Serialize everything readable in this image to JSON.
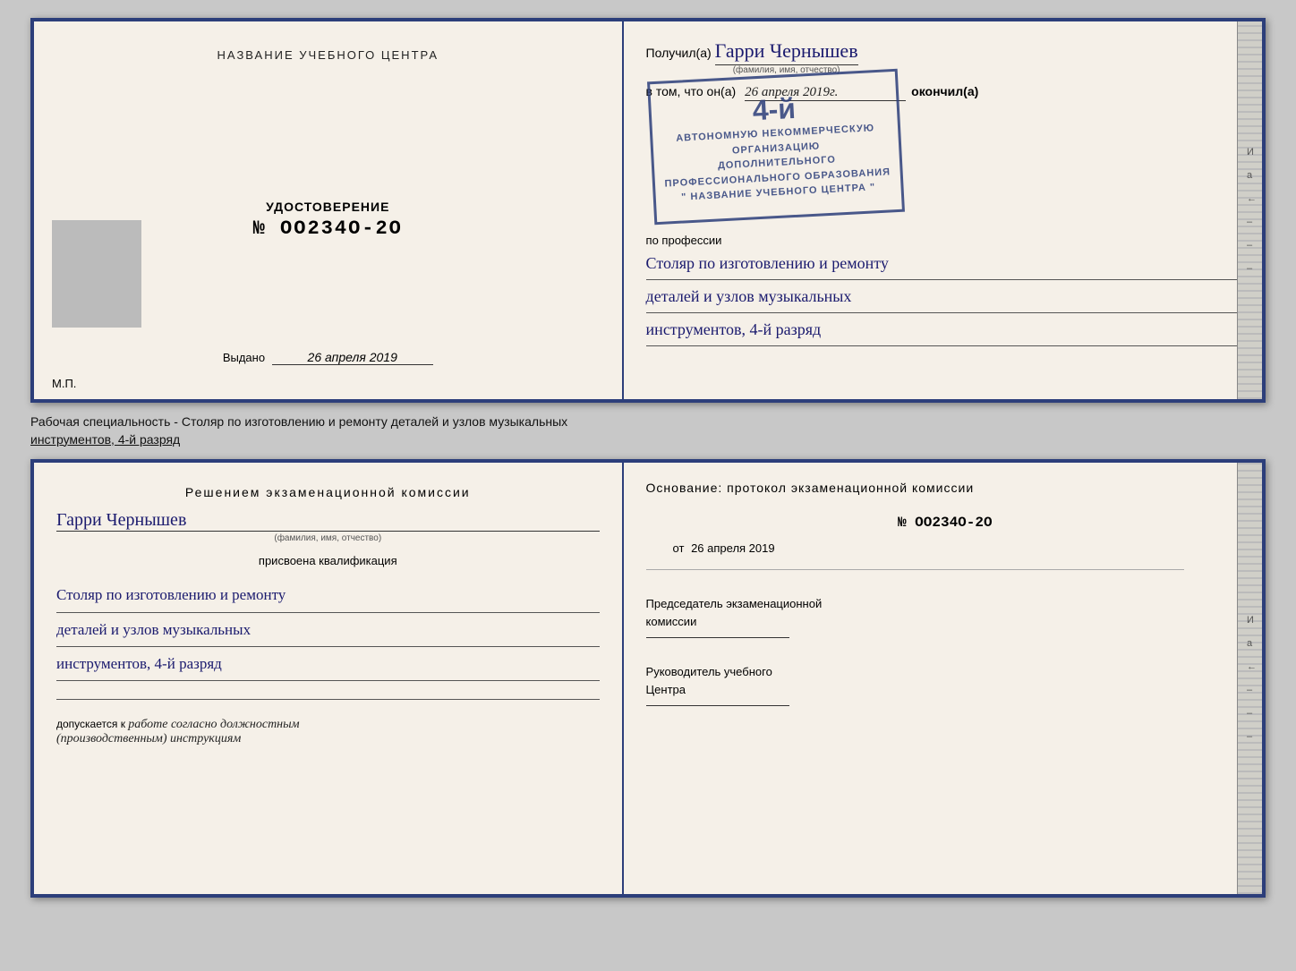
{
  "top_left": {
    "center_title": "НАЗВАНИЕ УЧЕБНОГО ЦЕНТРА",
    "cert_label": "УДОСТОВЕРЕНИЕ",
    "cert_number": "№ OO234O-2O",
    "issued_prefix": "Выдано",
    "issued_date": "26 апреля 2019",
    "mp": "М.П."
  },
  "top_right": {
    "poluchil": "Получил(а)",
    "name": "Гарри Чернышев",
    "name_sub": "(фамилия, имя, отчество)",
    "vtom": "в том, что он(а)",
    "date": "26 апреля 2019г.",
    "okoncil": "окончил(а)",
    "stamp_line1": "4-й",
    "stamp_line2": "АВТОНОМНУЮ НЕКОММЕРЧЕСКУЮ ОРГАНИЗАЦИЮ",
    "stamp_line3": "ДОПОЛНИТЕЛЬНОГО ПРОФЕССИОНАЛЬНОГО ОБРАЗОВАНИЯ",
    "stamp_line4": "\" НАЗВАНИЕ УЧЕБНОГО ЦЕНТРА \"",
    "po_professii": "по профессии",
    "profession_line1": "Столяр по изготовлению и ремонту",
    "profession_line2": "деталей и узлов музыкальных",
    "profession_line3": "инструментов, 4-й разряд"
  },
  "caption": {
    "text1": "Рабочая специальность - Столяр по изготовлению и ремонту деталей и узлов музыкальных",
    "text2": "инструментов, 4-й разряд"
  },
  "bottom_left": {
    "section_title": "Решением  экзаменационной  комиссии",
    "name": "Гарри Чернышев",
    "name_sub": "(фамилия, имя, отчество)",
    "assigned": "присвоена квалификация",
    "prof1": "Столяр по изготовлению и ремонту",
    "prof2": "деталей и узлов музыкальных",
    "prof3": "инструментов, 4-й разряд",
    "dopusk_prefix": "допускается к",
    "dopusk_hand": "работе согласно должностным",
    "dopusk_hand2": "(производственным) инструкциям"
  },
  "bottom_right": {
    "osnov": "Основание: протокол экзаменационной  комиссии",
    "number": "№  OO234O-2O",
    "ot_prefix": "от",
    "ot_date": "26 апреля 2019",
    "predsedatel_label": "Председатель экзаменационной",
    "predsedatel_label2": "комиссии",
    "rukovod_label": "Руководитель учебного",
    "rukovod_label2": "Центра"
  },
  "side_labels": [
    "И",
    "а",
    "←",
    "",
    "",
    "",
    ""
  ]
}
